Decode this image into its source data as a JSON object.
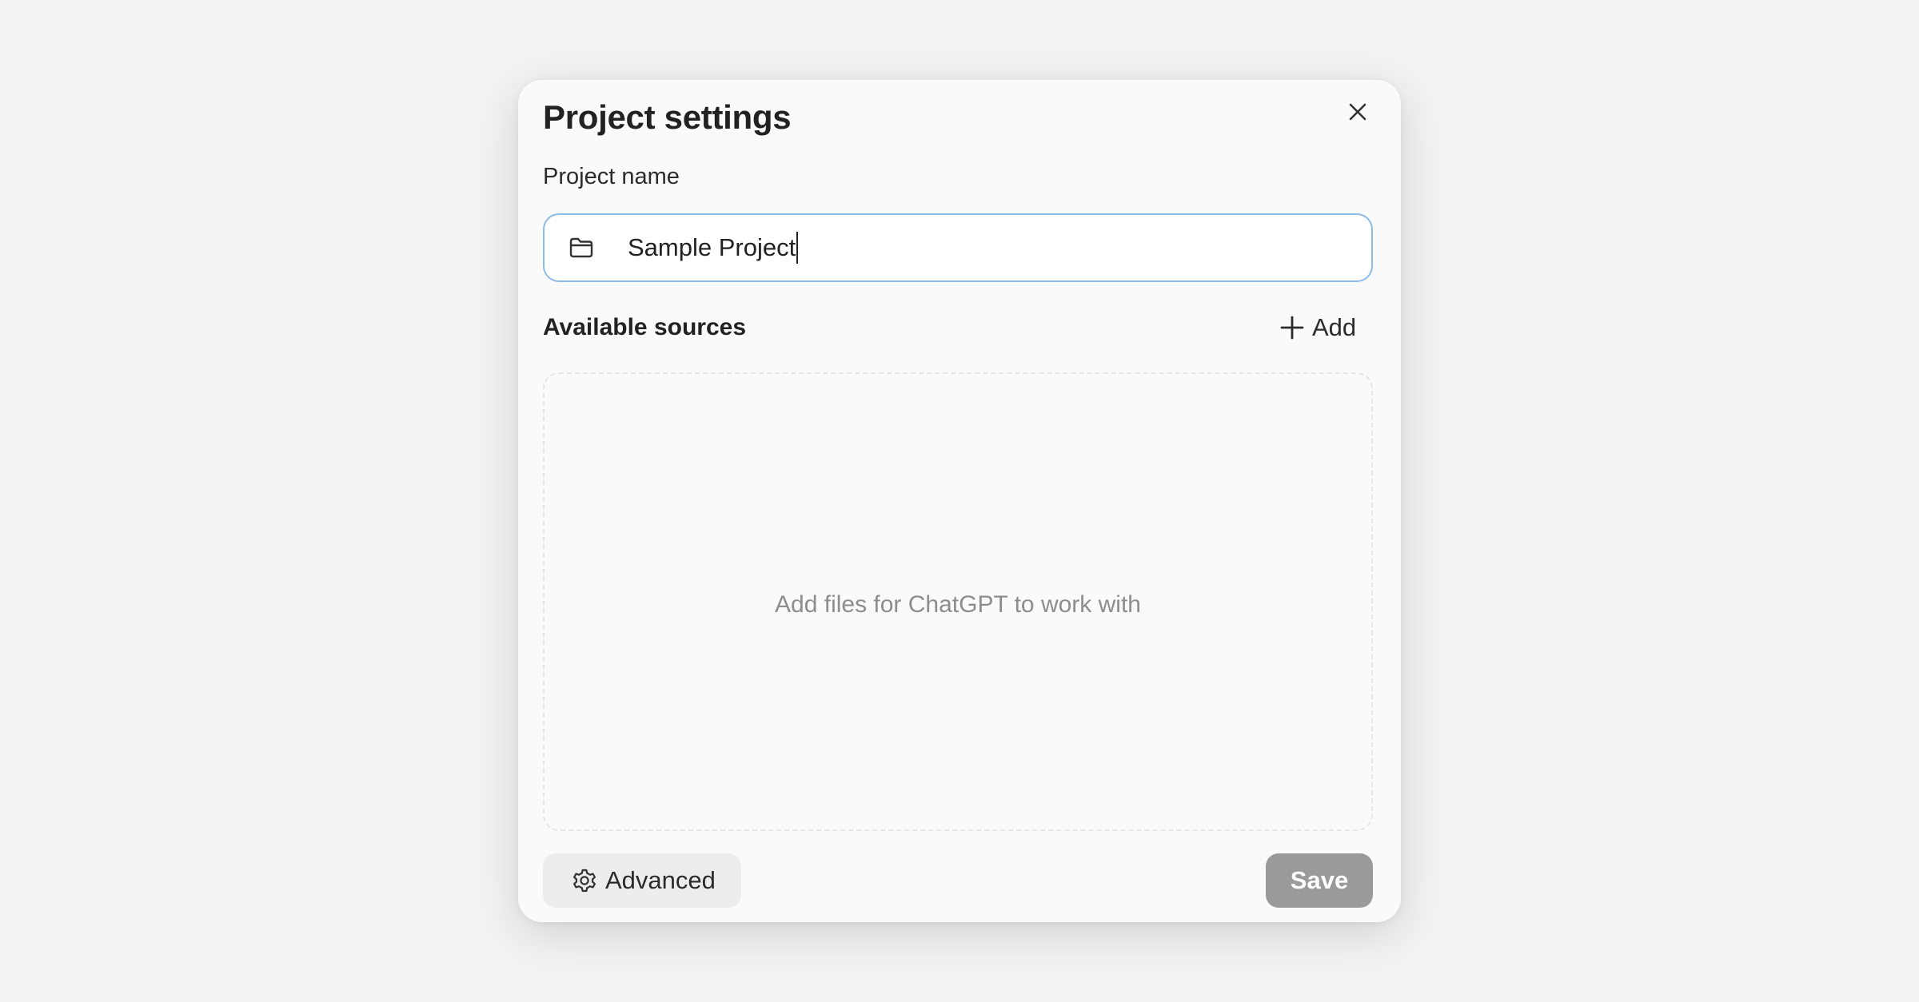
{
  "dialog": {
    "title": "Project settings",
    "close_icon": "close-icon",
    "name_field": {
      "label": "Project name",
      "value": "Sample Project",
      "icon": "folder-icon",
      "focus_border_color": "#8cbbe6"
    },
    "sources": {
      "heading": "Available sources",
      "add_label": "Add",
      "add_icon": "plus-icon",
      "empty_text": "Add files for ChatGPT to work with"
    },
    "footer": {
      "advanced_label": "Advanced",
      "advanced_icon": "gear-icon",
      "save_label": "Save",
      "save_color": "#9a9a9a"
    }
  }
}
